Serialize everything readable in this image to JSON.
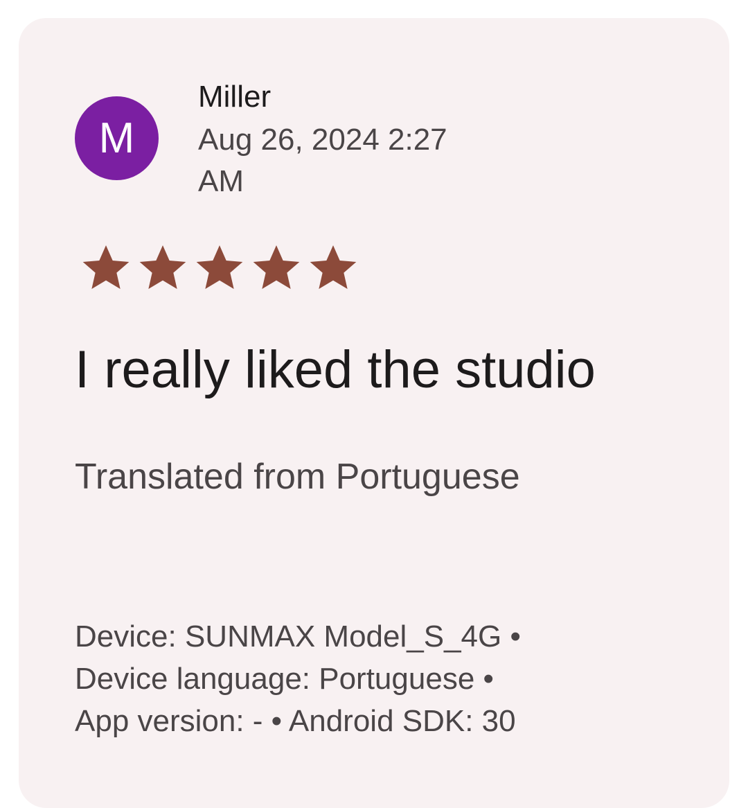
{
  "review": {
    "avatar_letter": "M",
    "avatar_color": "#7b1fa2",
    "author": "Miller",
    "date": "Aug 26, 2024 2:27 AM",
    "rating": 5,
    "rating_max": 5,
    "star_color": "#8c4a3a",
    "text": "I really liked the studio",
    "translated_note": "Translated from Portuguese"
  },
  "meta": {
    "device": "Device: SUNMAX Model_S_4G •",
    "device_language": "Device language: Portuguese •",
    "app_version": "App version: - • Android SDK: 30"
  }
}
